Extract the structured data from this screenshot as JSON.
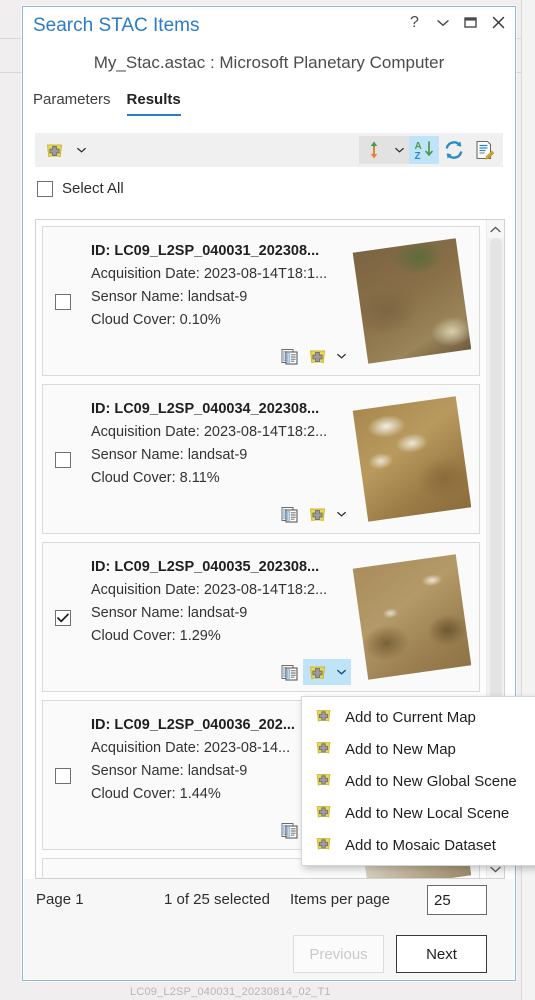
{
  "window": {
    "title": "Search STAC Items",
    "subtitle": "My_Stac.astac : Microsoft Planetary Computer",
    "controls": [
      {
        "name": "help-button",
        "glyph": "?"
      },
      {
        "name": "collapse-button",
        "glyph": "chevron-down-icon"
      },
      {
        "name": "maximize-button",
        "glyph": "maximize-icon"
      },
      {
        "name": "close-button",
        "glyph": "close-icon"
      }
    ]
  },
  "tabs": [
    {
      "label": "Parameters",
      "active": false
    },
    {
      "label": "Results",
      "active": true
    }
  ],
  "toolbar": {
    "add_button_name": "add-to-map-button",
    "add_caret_name": "add-to-map-caret",
    "sort_direction_name": "sort-direction-button",
    "sort_direction_caret_name": "sort-direction-caret",
    "sort_az_name": "sort-az-button",
    "refresh_name": "refresh-button",
    "edit_details_name": "edit-details-button"
  },
  "select_all": {
    "label": "Select All",
    "checked": false
  },
  "results": [
    {
      "id": "ID: LC09_L2SP_040031_202308...",
      "acquisition": "Acquisition Date: 2023-08-14T18:1...",
      "sensor": "Sensor Name: landsat-9",
      "cloud": "Cloud Cover: 0.10%",
      "checked": false,
      "menu_open": false,
      "thumb_colors": [
        "#6f5b3e",
        "#8a7048",
        "#5d6b3a",
        "#9a8459",
        "#c9b88f"
      ]
    },
    {
      "id": "ID: LC09_L2SP_040034_202308...",
      "acquisition": "Acquisition Date: 2023-08-14T18:2...",
      "sensor": "Sensor Name: landsat-9",
      "cloud": "Cloud Cover: 8.11%",
      "checked": false,
      "menu_open": false,
      "thumb_colors": [
        "#9c7c46",
        "#b08f54",
        "#d8cfae",
        "#8a6c3c",
        "#e5e0cd"
      ]
    },
    {
      "id": "ID: LC09_L2SP_040035_202308...",
      "acquisition": "Acquisition Date: 2023-08-14T18:2...",
      "sensor": "Sensor Name: landsat-9",
      "cloud": "Cloud Cover: 1.29%",
      "checked": true,
      "menu_open": true,
      "thumb_colors": [
        "#9d8152",
        "#b49a68",
        "#7a6238",
        "#c3ad7f",
        "#8e7345"
      ]
    },
    {
      "id": "ID: LC09_L2SP_040036_202...",
      "acquisition": "Acquisition Date: 2023-08-14...",
      "sensor": "Sensor Name: landsat-9",
      "cloud": "Cloud Cover: 1.44%",
      "checked": false,
      "menu_open": false,
      "thumb_colors": [
        "#a08a5c",
        "#b9a478",
        "#6f5a34",
        "#cdbb92",
        "#8d7648"
      ]
    }
  ],
  "partial_result": {
    "thumb_colors": [
      "#cfc6b0",
      "#e6e2d6",
      "#9a8b6b",
      "#f0ece2",
      "#b5a78a"
    ]
  },
  "context_menu": {
    "items": [
      {
        "label": "Add to Current  Map",
        "name": "menu-add-to-current-map"
      },
      {
        "label": "Add to New Map",
        "name": "menu-add-to-new-map"
      },
      {
        "label": "Add to New Global Scene",
        "name": "menu-add-to-new-global-scene"
      },
      {
        "label": "Add to New Local Scene",
        "name": "menu-add-to-new-local-scene"
      },
      {
        "label": "Add to Mosaic Dataset",
        "name": "menu-add-to-mosaic-dataset"
      }
    ]
  },
  "footer": {
    "page_label": "Page 1",
    "selection_label": "1 of 25 selected",
    "items_per_page_label": "Items per page",
    "items_per_page_value": "25",
    "previous_label": "Previous",
    "next_label": "Next",
    "previous_disabled": true
  },
  "colors": {
    "title_blue": "#2a7cc7",
    "accent_blue": "#2a7cc7",
    "highlight": "#bfe3f7",
    "basket_yellow": "#edd84e"
  },
  "backdrop_text": "LC09_L2SP_040031_20230814_02_T1"
}
